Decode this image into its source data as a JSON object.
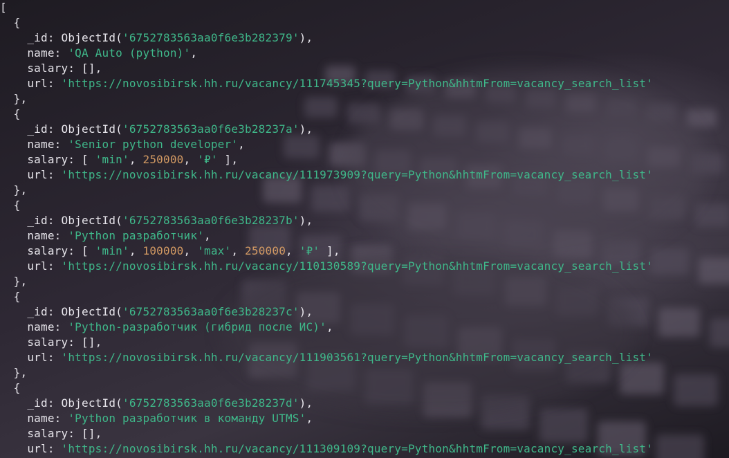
{
  "theme": {
    "string_color": "#3fb88a",
    "number_color": "#d39a63",
    "text_color": "#e8e6ec"
  },
  "output": {
    "open_bracket": "[",
    "documents": [
      {
        "id": "6752783563aa0f6e3b282379",
        "name": "QA Auto (python)",
        "salary": [],
        "url": "https://novosibirsk.hh.ru/vacancy/111745345?query=Python&hhtmFrom=vacancy_search_list"
      },
      {
        "id": "6752783563aa0f6e3b28237a",
        "name": "Senior python developer",
        "salary": [
          "min",
          250000,
          "₽"
        ],
        "url": "https://novosibirsk.hh.ru/vacancy/111973909?query=Python&hhtmFrom=vacancy_search_list"
      },
      {
        "id": "6752783563aa0f6e3b28237b",
        "name": "Python разработчик",
        "salary": [
          "min",
          100000,
          "max",
          250000,
          "₽"
        ],
        "url": "https://novosibirsk.hh.ru/vacancy/110130589?query=Python&hhtmFrom=vacancy_search_list"
      },
      {
        "id": "6752783563aa0f6e3b28237c",
        "name": "Python-разработчик (гибрид после ИС)",
        "salary": [],
        "url": "https://novosibirsk.hh.ru/vacancy/111903561?query=Python&hhtmFrom=vacancy_search_list"
      },
      {
        "id": "6752783563aa0f6e3b28237d",
        "name": "Python разработчик в команду UTMS",
        "salary": [],
        "url": "https://novosibirsk.hh.ru/vacancy/111309109?query=Python&hhtmFrom=vacancy_search_list"
      }
    ]
  }
}
